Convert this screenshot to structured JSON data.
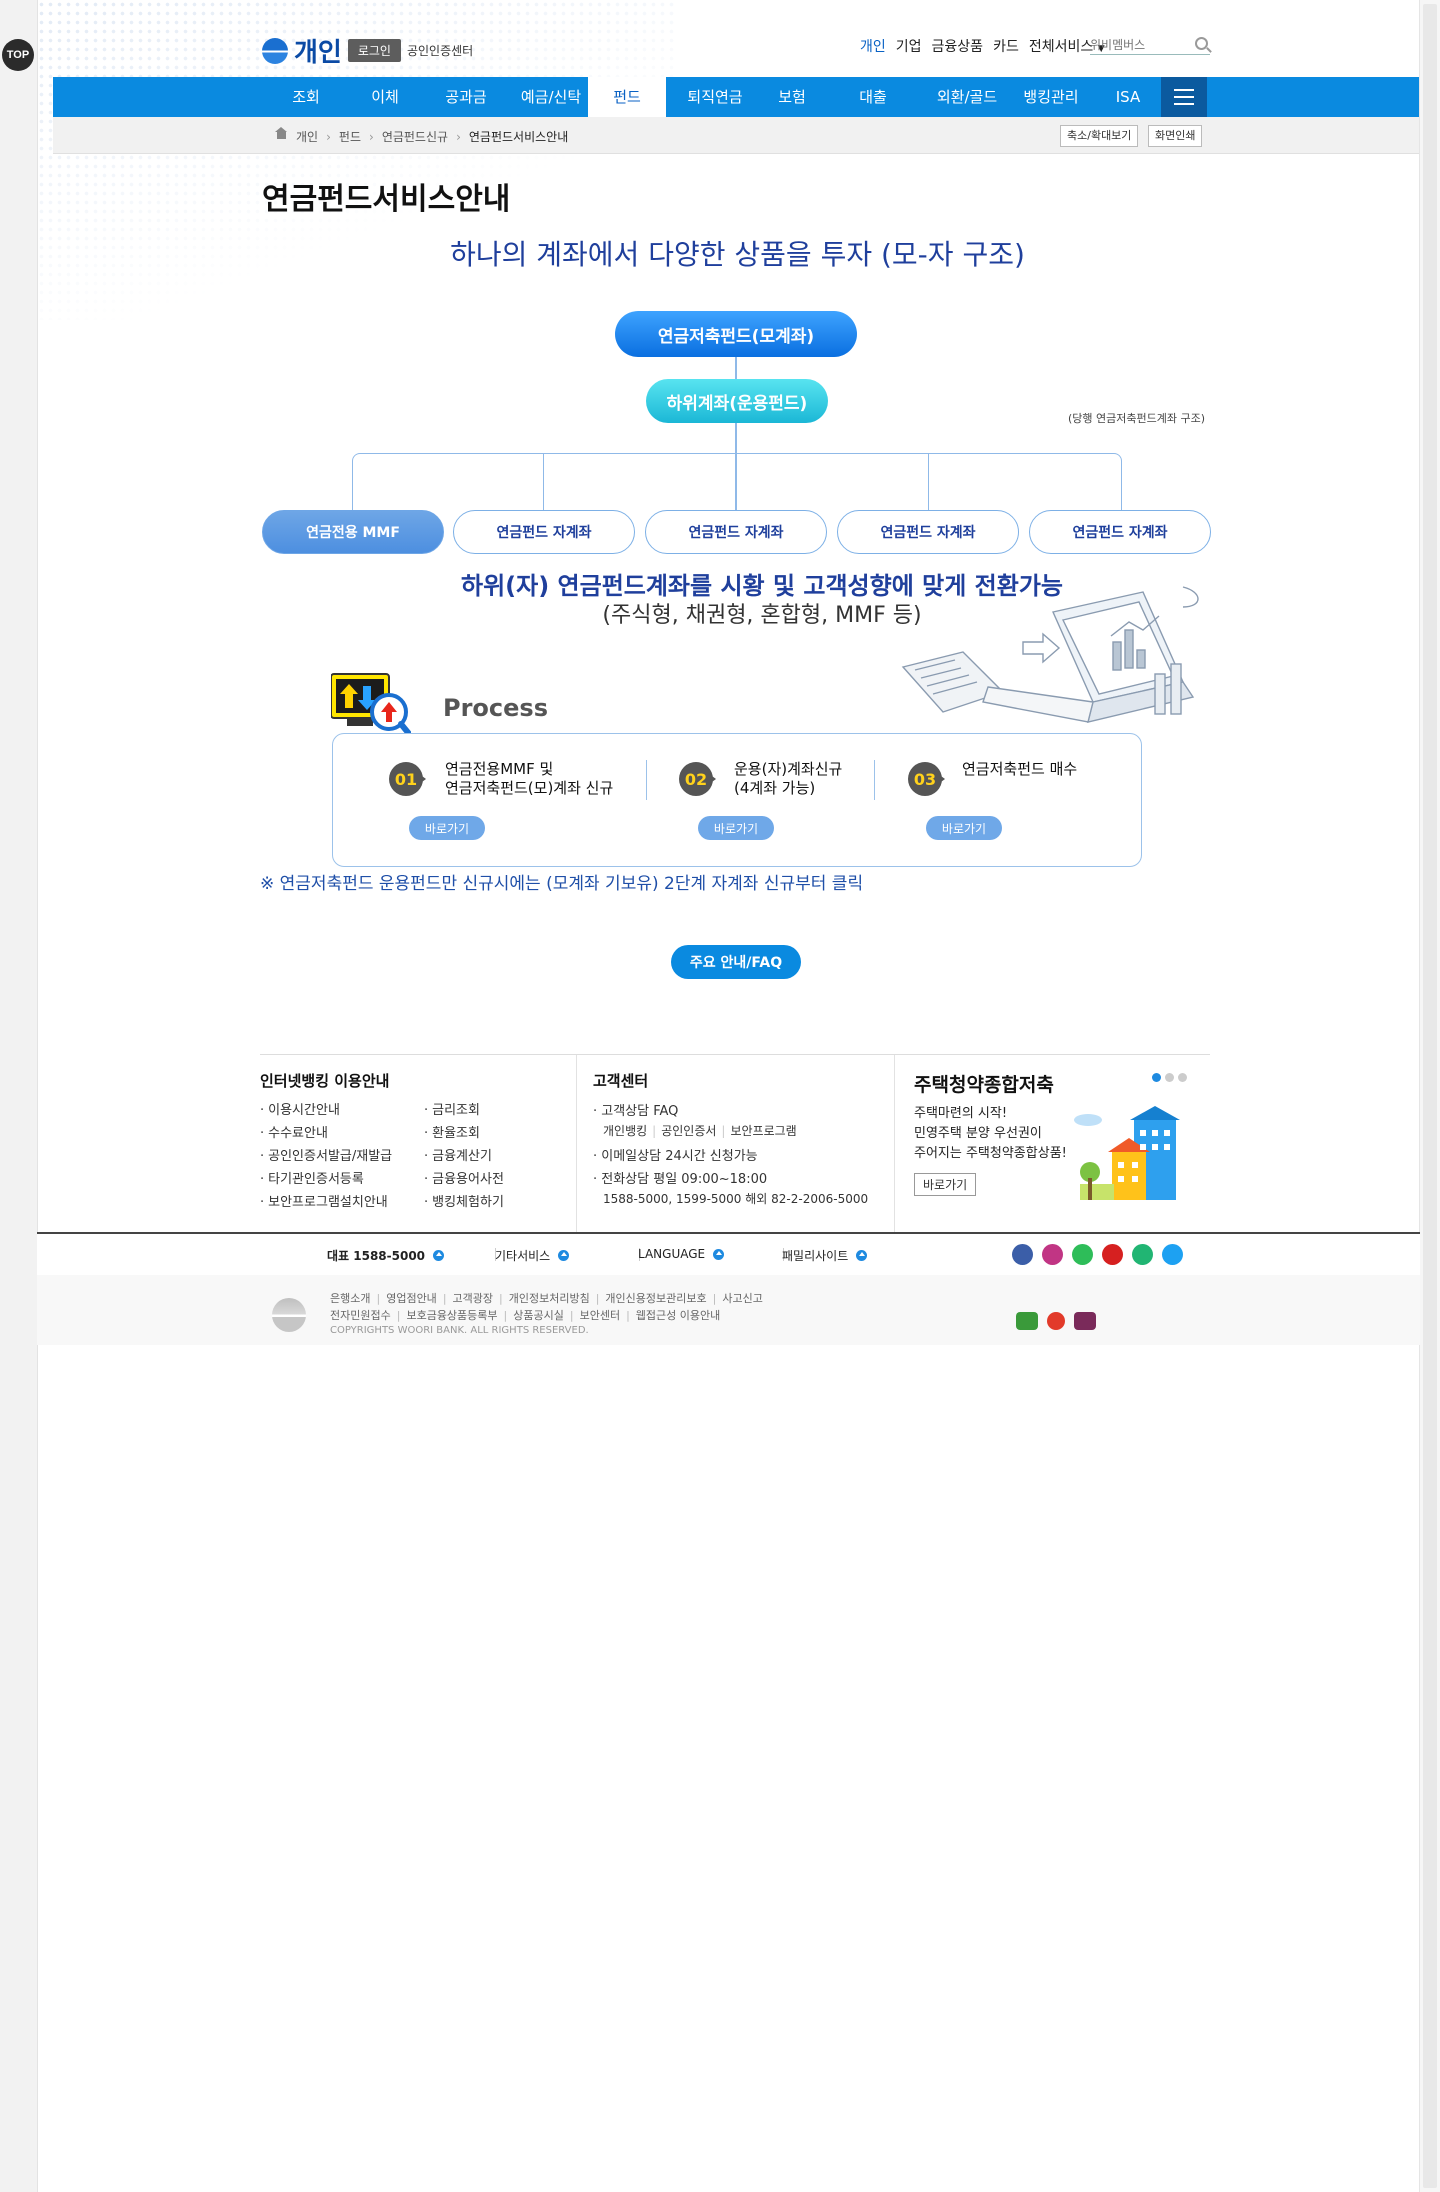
{
  "side": {
    "top_button": "TOP"
  },
  "header": {
    "logo_text": "개인",
    "login_label": "로그인",
    "cert_center_label": "공인인증센터",
    "util_links": [
      "개인",
      "기업",
      "금융상품",
      "카드",
      "전체서비스"
    ],
    "search_placeholder": "위비멤버스"
  },
  "gnb": {
    "items": [
      "조회",
      "이체",
      "공과금",
      "예금/신탁",
      "펀드",
      "퇴직연금",
      "보험",
      "대출",
      "외환/골드",
      "뱅킹관리",
      "ISA"
    ],
    "active": "펀드"
  },
  "location": {
    "crumbs": [
      "개인",
      "펀드",
      "연금펀드신규",
      "연금펀드서비스안내"
    ],
    "zoom_label": "축소/확대보기",
    "print_label": "화면인쇄"
  },
  "content": {
    "page_title": "연금펀드서비스안내",
    "headline": "하나의 계좌에서 다양한 상품을 투자 (모-자 구조)",
    "parent_account": "연금저축펀드(모계좌)",
    "sub_account": "하위계좌(운용펀드)",
    "structure_note": "(당행 연금저축펀드계좌 구조)",
    "children": [
      "연금전용 MMF",
      "연금펀드 자계좌",
      "연금펀드 자계좌",
      "연금펀드 자계좌",
      "연금펀드 자계좌"
    ],
    "switch_line1": "하위(자) 연금펀드계좌를 시황 및 고객성향에 맞게 전환가능",
    "switch_line2": "(주식형, 채권형, 혼합형, MMF 등)",
    "process_label": "Process",
    "steps": [
      {
        "num": "01",
        "text": "연금전용MMF 및\n연금저축펀드(모)계좌 신규",
        "button": "바로가기"
      },
      {
        "num": "02",
        "text": "운용(자)계좌신규\n(4계좌 가능)",
        "button": "바로가기"
      },
      {
        "num": "03",
        "text": "연금저축펀드 매수",
        "button": "바로가기"
      }
    ],
    "notice": "※ 연금저축펀드 운용펀드만 신규시에는 (모계좌 기보유) 2단계 자계좌 신규부터 클릭",
    "faq_button": "주요 안내/FAQ"
  },
  "info": {
    "banking_title": "인터넷뱅킹 이용안내",
    "banking_col1": [
      "이용시간안내",
      "수수료안내",
      "공인인증서발급/재발급",
      "타기관인증서등록",
      "보안프로그램설치안내"
    ],
    "banking_col2": [
      "금리조회",
      "환율조회",
      "금융계산기",
      "금융용어사전",
      "뱅킹체험하기"
    ],
    "cs_title": "고객센터",
    "cs_faq": "고객상담 FAQ",
    "cs_faq_links": [
      "개인뱅킹",
      "공인인증서",
      "보안프로그램"
    ],
    "cs_email": "이메일상담 24시간 신청가능",
    "cs_phone": "전화상담 평일 09:00~18:00",
    "cs_numbers": "1588-5000, 1599-5000 해외 82-2-2006-5000",
    "promo_title": "주택청약종합저축",
    "promo_desc": "주택마련의 시작!\n민영주택 분양 우선권이\n주어지는 주택청약종합상품!",
    "promo_button": "바로가기"
  },
  "footer": {
    "phone": "대표 1588-5000",
    "other_services": "기타서비스",
    "language": "LANGUAGE",
    "family_sites": "패밀리사이트",
    "links_row1": [
      "은행소개",
      "영업점안내",
      "고객광장",
      "개인정보처리방침",
      "개인신용정보관리보호",
      "사고신고"
    ],
    "links_row2": [
      "전자민원접수",
      "보호금융상품등록부",
      "상품공시실",
      "보안센터",
      "웹접근성 이용안내"
    ],
    "copyright": "COPYRIGHTS WOORI BANK. ALL RIGHTS RESERVED."
  },
  "colors": {
    "brand_blue": "#0a8ae0",
    "nav_dark": "#0b5a9f",
    "headline": "#1f3f9c"
  },
  "icons": [
    "home-icon",
    "search-icon",
    "menu-icon",
    "monitor-chart-icon",
    "calculator-laptop-illustration",
    "building-illustration",
    "facebook-icon",
    "instagram-icon",
    "blog-icon",
    "youtube-icon",
    "play-icon",
    "twitter-icon"
  ]
}
